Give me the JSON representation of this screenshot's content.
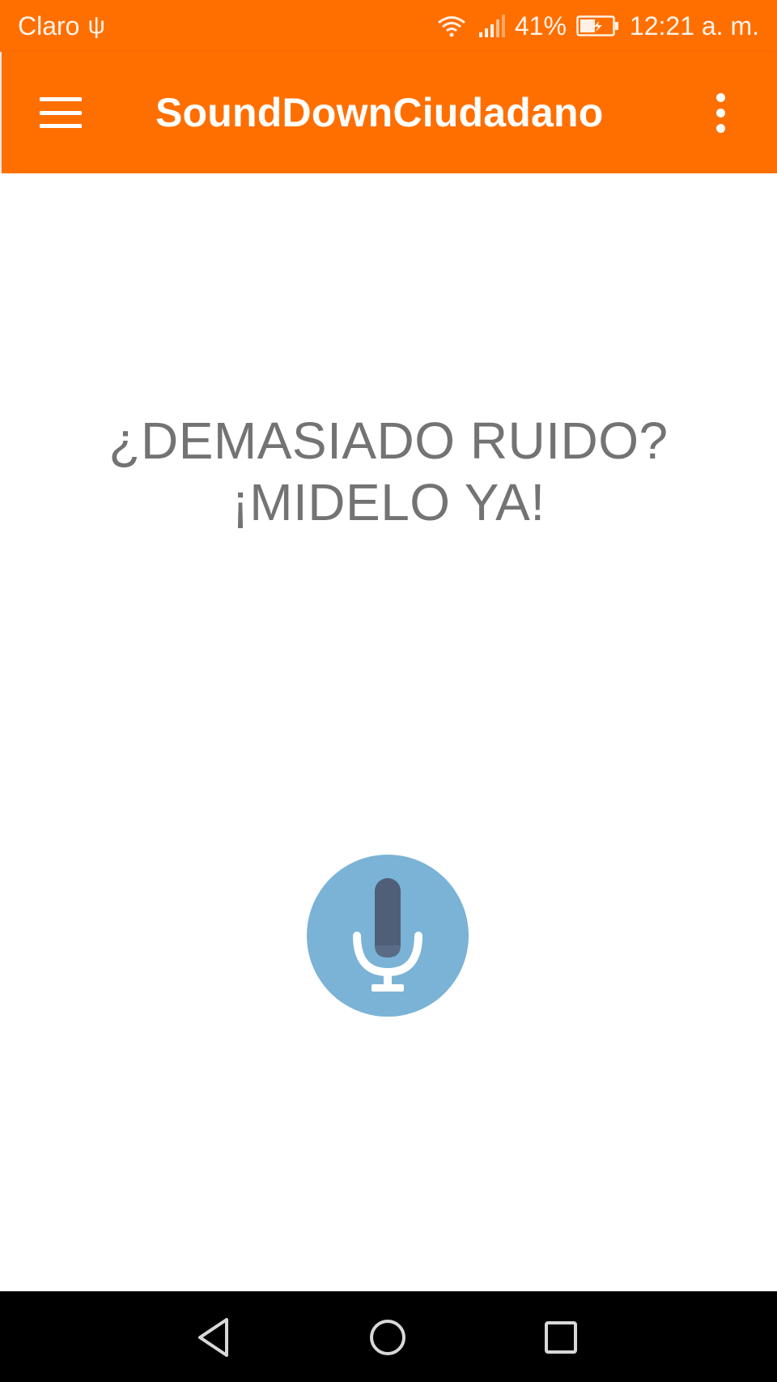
{
  "status_bar": {
    "carrier": "Claro",
    "usb_glyph": "ψ",
    "battery_percent": "41%",
    "time": "12:21 a. m."
  },
  "app_bar": {
    "title": "SoundDownCiudadano",
    "menu_icon": "hamburger-menu-icon",
    "overflow_icon": "more-vert-icon"
  },
  "content": {
    "headline_line1": "¿DEMASIADO RUIDO?",
    "headline_line2": "¡MIDELO YA!",
    "mic_icon": "microphone-icon"
  },
  "colors": {
    "primary": "#ff6f00",
    "headline_text": "#737373",
    "mic_circle": "#7ab3d6",
    "mic_body": "#4f5f78"
  },
  "navigation": {
    "back_icon": "back-triangle-icon",
    "home_icon": "home-circle-icon",
    "recents_icon": "recents-square-icon"
  }
}
